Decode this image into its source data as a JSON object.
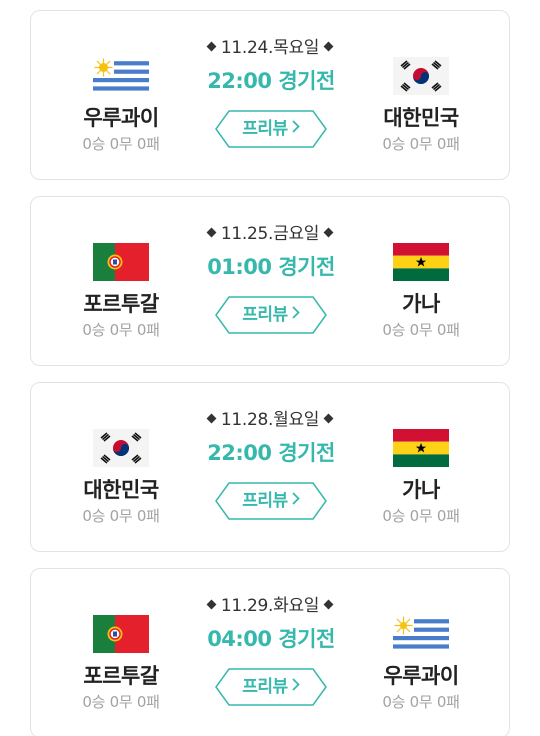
{
  "matches": [
    {
      "date": "11.24.목요일",
      "kickoff": "22:00 경기전",
      "preview_label": "프리뷰",
      "home": {
        "name": "우루과이",
        "record": "0승 0무 0패",
        "flag": "uruguay-flag-icon"
      },
      "away": {
        "name": "대한민국",
        "record": "0승 0무 0패",
        "flag": "korea-flag-icon"
      }
    },
    {
      "date": "11.25.금요일",
      "kickoff": "01:00 경기전",
      "preview_label": "프리뷰",
      "home": {
        "name": "포르투갈",
        "record": "0승 0무 0패",
        "flag": "portugal-flag-icon"
      },
      "away": {
        "name": "가나",
        "record": "0승 0무 0패",
        "flag": "ghana-flag-icon"
      }
    },
    {
      "date": "11.28.월요일",
      "kickoff": "22:00 경기전",
      "preview_label": "프리뷰",
      "home": {
        "name": "대한민국",
        "record": "0승 0무 0패",
        "flag": "korea-flag-icon"
      },
      "away": {
        "name": "가나",
        "record": "0승 0무 0패",
        "flag": "ghana-flag-icon"
      }
    },
    {
      "date": "11.29.화요일",
      "kickoff": "04:00 경기전",
      "preview_label": "프리뷰",
      "home": {
        "name": "포르투갈",
        "record": "0승 0무 0패",
        "flag": "portugal-flag-icon"
      },
      "away": {
        "name": "우루과이",
        "record": "0승 0무 0패",
        "flag": "uruguay-flag-icon"
      }
    }
  ],
  "colors": {
    "accent": "#36b8ad",
    "team_name": "#222222",
    "record": "#a3a3a3",
    "card_border": "#e3e3e3"
  }
}
